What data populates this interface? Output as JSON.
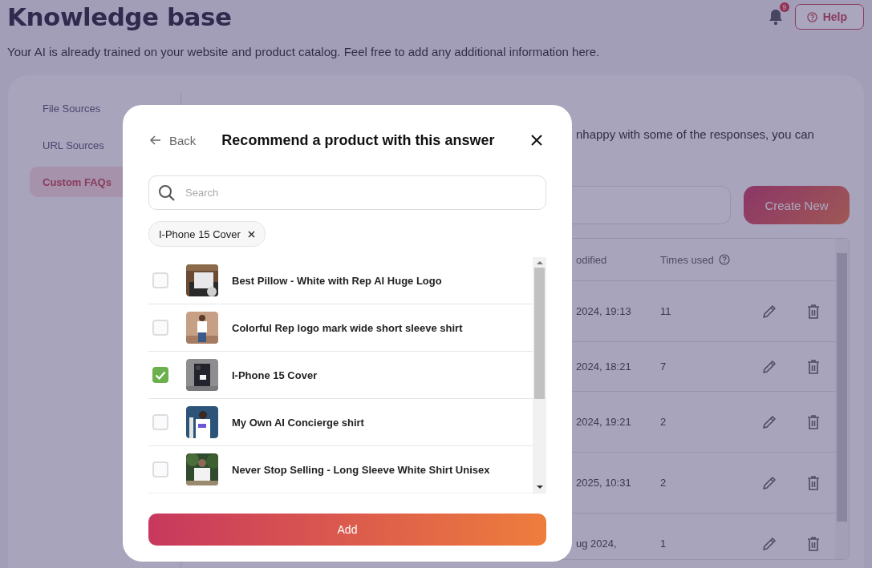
{
  "header": {
    "title": "Knowledge base",
    "notifications_count": "9",
    "help_button": "Help",
    "subtitle": "Your AI is already trained on your website and product catalog. Feel free to add any additional information here."
  },
  "sidebar": {
    "items": [
      {
        "label": "File Sources",
        "selected": false
      },
      {
        "label": "URL Sources",
        "selected": false
      },
      {
        "label": "Custom FAQs",
        "selected": true
      }
    ]
  },
  "content": {
    "description": "nhappy with some of the responses, you can",
    "create_button": "Create New"
  },
  "table": {
    "columns": [
      "odified",
      "Times used"
    ],
    "rows": [
      {
        "modified": "2024, 19:13",
        "times_used": "11"
      },
      {
        "modified": "2024, 18:21",
        "times_used": "7"
      },
      {
        "modified": "2024, 19:21",
        "times_used": "2"
      },
      {
        "modified": "2025, 10:31",
        "times_used": "2"
      },
      {
        "modified": "ug 2024,",
        "times_used": "1"
      }
    ]
  },
  "modal": {
    "back": "Back",
    "title": "Recommend a product with this answer",
    "search": {
      "placeholder": "Search"
    },
    "chips": [
      "I-Phone 15 Cover"
    ],
    "products": [
      {
        "name": "Best Pillow - White with Rep AI Huge Logo",
        "checked": false
      },
      {
        "name": "Colorful Rep logo mark wide short sleeve shirt",
        "checked": false
      },
      {
        "name": "I-Phone 15 Cover",
        "checked": true
      },
      {
        "name": "My Own AI Concierge shirt",
        "checked": false
      },
      {
        "name": "Never Stop Selling - Long Sleeve White Shirt Unisex",
        "checked": false
      }
    ],
    "add_button": "Add"
  }
}
